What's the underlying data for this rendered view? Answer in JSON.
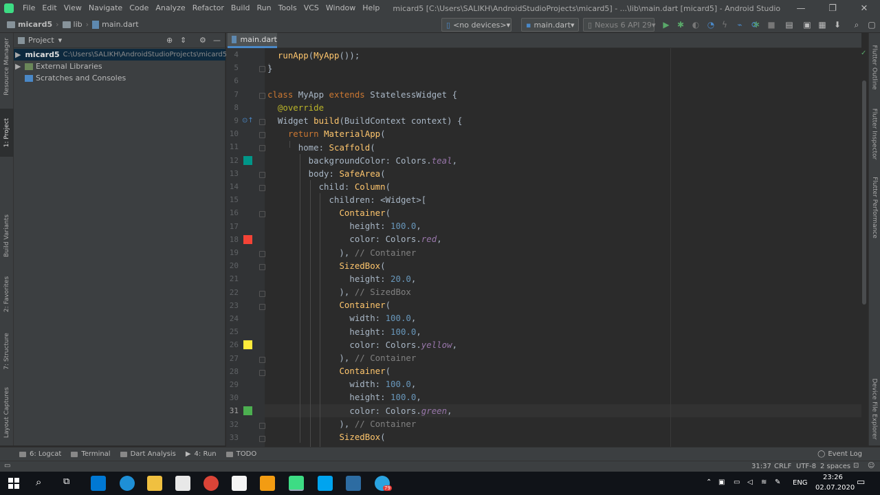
{
  "window": {
    "title": "micard5 [C:\\Users\\SALIKH\\AndroidStudioProjects\\micard5] - ...\\lib\\main.dart [micard5] - Android Studio",
    "controls": [
      "—",
      "❐",
      "✕"
    ]
  },
  "menu": [
    "File",
    "Edit",
    "View",
    "Navigate",
    "Code",
    "Analyze",
    "Refactor",
    "Build",
    "Run",
    "Tools",
    "VCS",
    "Window",
    "Help"
  ],
  "breadcrumb": [
    "micard5",
    "lib",
    "main.dart"
  ],
  "toolbar": {
    "device": "<no devices>",
    "run_config": "main.dart",
    "emulator": "Nexus 6 API 29"
  },
  "left_tabs": [
    "Resource Manager",
    "1: Project",
    "Build Variants",
    "2: Favorites",
    "7: Structure",
    "Layout Captures"
  ],
  "project_panel": {
    "title": "Project",
    "items": [
      {
        "name": "micard5",
        "path": "C:\\Users\\SALIKH\\AndroidStudioProjects\\micard5"
      },
      {
        "name": "External Libraries",
        "path": ""
      },
      {
        "name": "Scratches and Consoles",
        "path": ""
      }
    ]
  },
  "editor": {
    "tab": "main.dart",
    "lines": [
      4,
      5,
      6,
      7,
      8,
      9,
      10,
      11,
      12,
      13,
      14,
      15,
      16,
      17,
      18,
      19,
      20,
      21,
      22,
      23,
      24,
      25,
      26,
      27,
      28,
      29,
      30,
      31,
      32,
      33
    ]
  },
  "right_tabs": [
    "Flutter Outline",
    "Flutter Inspector",
    "Flutter Performance",
    "Device File Explorer"
  ],
  "bottom_tools": [
    "6: Logcat",
    "Terminal",
    "Dart Analysis",
    "4: Run",
    "TODO"
  ],
  "event_log": "Event Log",
  "status": {
    "position": "31:37",
    "line_sep": "CRLF",
    "encoding": "UTF-8",
    "indent": "2 spaces"
  },
  "taskbar": {
    "lang": "ENG",
    "time": "23:26",
    "date": "02.07.2020",
    "badge": "79"
  },
  "colors": {
    "teal": "#009688",
    "red": "#f44336",
    "yellow": "#ffeb3b",
    "green": "#4caf50"
  }
}
